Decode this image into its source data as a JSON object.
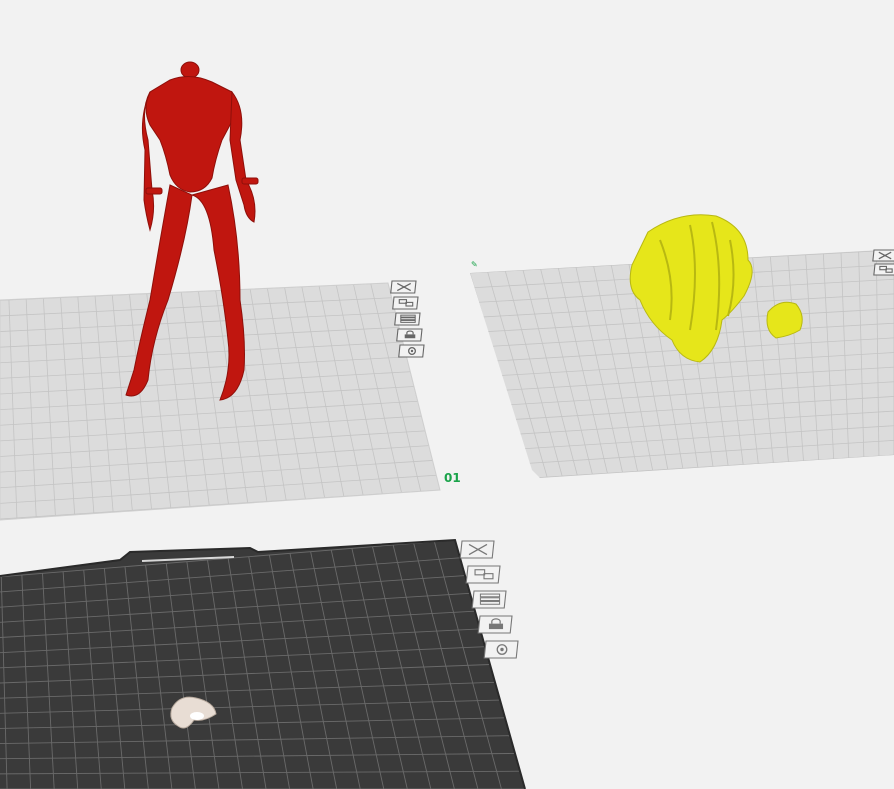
{
  "viewport": {
    "background": "#f2f2f2"
  },
  "plates": [
    {
      "id": "plate-left",
      "label": "01",
      "surface": "#dcdcdc",
      "grid": "#c4c4c4",
      "tools": [
        "close-icon",
        "arrange-icon",
        "layers-icon",
        "lock-icon",
        "settings-icon"
      ]
    },
    {
      "id": "plate-right",
      "label": "",
      "surface": "#dcdcdc",
      "grid": "#c4c4c4",
      "tools": [
        "close-icon",
        "arrange-icon"
      ]
    },
    {
      "id": "plate-active",
      "label": "",
      "surface": "#3a3a3a",
      "grid": "#6a6a6a",
      "tools": [
        "close-icon",
        "arrange-icon",
        "layers-icon",
        "lock-icon",
        "settings-icon"
      ]
    }
  ],
  "models": [
    {
      "name": "figure-body",
      "color": "#c0160f"
    },
    {
      "name": "hair-large",
      "color": "#e6e61a"
    },
    {
      "name": "hair-small",
      "color": "#e6e61a"
    },
    {
      "name": "small-part",
      "color": "#e8ddd4"
    }
  ],
  "colors": {
    "label_green": "#1aa34a",
    "tool_stroke": "#666666",
    "tool_stroke_active": "#777777"
  }
}
